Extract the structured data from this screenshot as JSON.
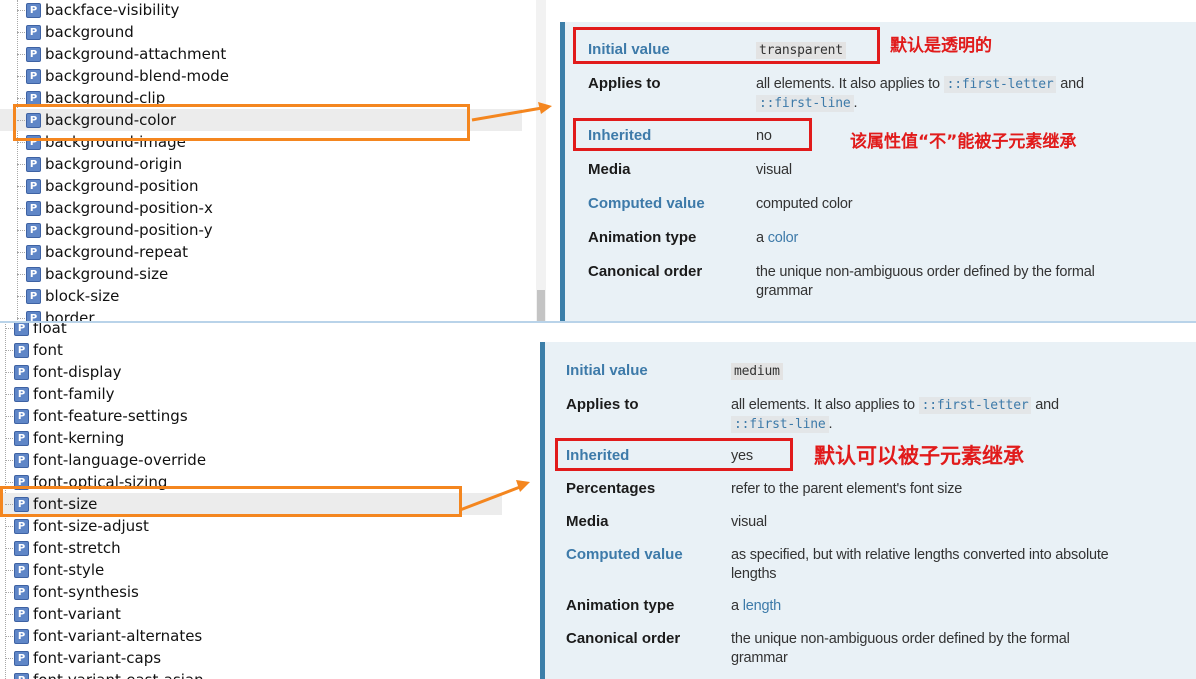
{
  "top_tree": {
    "items": [
      {
        "label": "backface-visibility"
      },
      {
        "label": "background"
      },
      {
        "label": "background-attachment"
      },
      {
        "label": "background-blend-mode"
      },
      {
        "label": "background-clip"
      },
      {
        "label": "background-color",
        "selected": true
      },
      {
        "label": "background-image"
      },
      {
        "label": "background-origin"
      },
      {
        "label": "background-position"
      },
      {
        "label": "background-position-x"
      },
      {
        "label": "background-position-y"
      },
      {
        "label": "background-repeat"
      },
      {
        "label": "background-size"
      },
      {
        "label": "block-size"
      },
      {
        "label": "border"
      }
    ]
  },
  "bottom_tree": {
    "items": [
      {
        "label": "float"
      },
      {
        "label": "font"
      },
      {
        "label": "font-display"
      },
      {
        "label": "font-family"
      },
      {
        "label": "font-feature-settings"
      },
      {
        "label": "font-kerning"
      },
      {
        "label": "font-language-override"
      },
      {
        "label": "font-optical-sizing"
      },
      {
        "label": "font-size",
        "selected": true
      },
      {
        "label": "font-size-adjust"
      },
      {
        "label": "font-stretch"
      },
      {
        "label": "font-style"
      },
      {
        "label": "font-synthesis"
      },
      {
        "label": "font-variant"
      },
      {
        "label": "font-variant-alternates"
      },
      {
        "label": "font-variant-caps"
      },
      {
        "label": "font-variant-east-asian"
      }
    ]
  },
  "icon_letter": "P",
  "top_props": {
    "initial_label": "Initial value",
    "initial_value": "transparent",
    "applies_label": "Applies to",
    "applies_text": "all elements. It also applies to",
    "applies_code1": "::first-letter",
    "applies_and": "and",
    "applies_code2": "::first-line",
    "applies_end": ".",
    "inherited_label": "Inherited",
    "inherited_value": "no",
    "media_label": "Media",
    "media_value": "visual",
    "computed_label": "Computed value",
    "computed_value": "computed color",
    "animation_label": "Animation type",
    "animation_prefix": "a",
    "animation_link": "color",
    "canonical_label": "Canonical order",
    "canonical_value": "the unique non-ambiguous order defined by the formal grammar"
  },
  "bottom_props": {
    "initial_label": "Initial value",
    "initial_value": "medium",
    "applies_label": "Applies to",
    "applies_text": "all elements. It also applies to",
    "applies_code1": "::first-letter",
    "applies_and": "and",
    "applies_code2": "::first-line",
    "applies_end": ".",
    "inherited_label": "Inherited",
    "inherited_value": "yes",
    "percentages_label": "Percentages",
    "percentages_value": "refer to the parent element's font size",
    "media_label": "Media",
    "media_value": "visual",
    "computed_label": "Computed value",
    "computed_value": "as specified, but with relative lengths converted into absolute lengths",
    "animation_label": "Animation type",
    "animation_prefix": "a",
    "animation_link": "length",
    "canonical_label": "Canonical order",
    "canonical_value": "the unique non-ambiguous order defined by the formal grammar"
  },
  "annotations": {
    "top_initial_note": "默认是透明的",
    "top_inherited_note": "该属性值“不”能被子元素继承",
    "bottom_inherited_note": "默认可以被子元素继承"
  },
  "colors": {
    "annotation_red": "#e11b1b",
    "highlight_orange": "#f4861f",
    "link_blue": "#3d7aa9",
    "box_background": "#e9f1f6",
    "box_border": "#3c7fa9"
  }
}
